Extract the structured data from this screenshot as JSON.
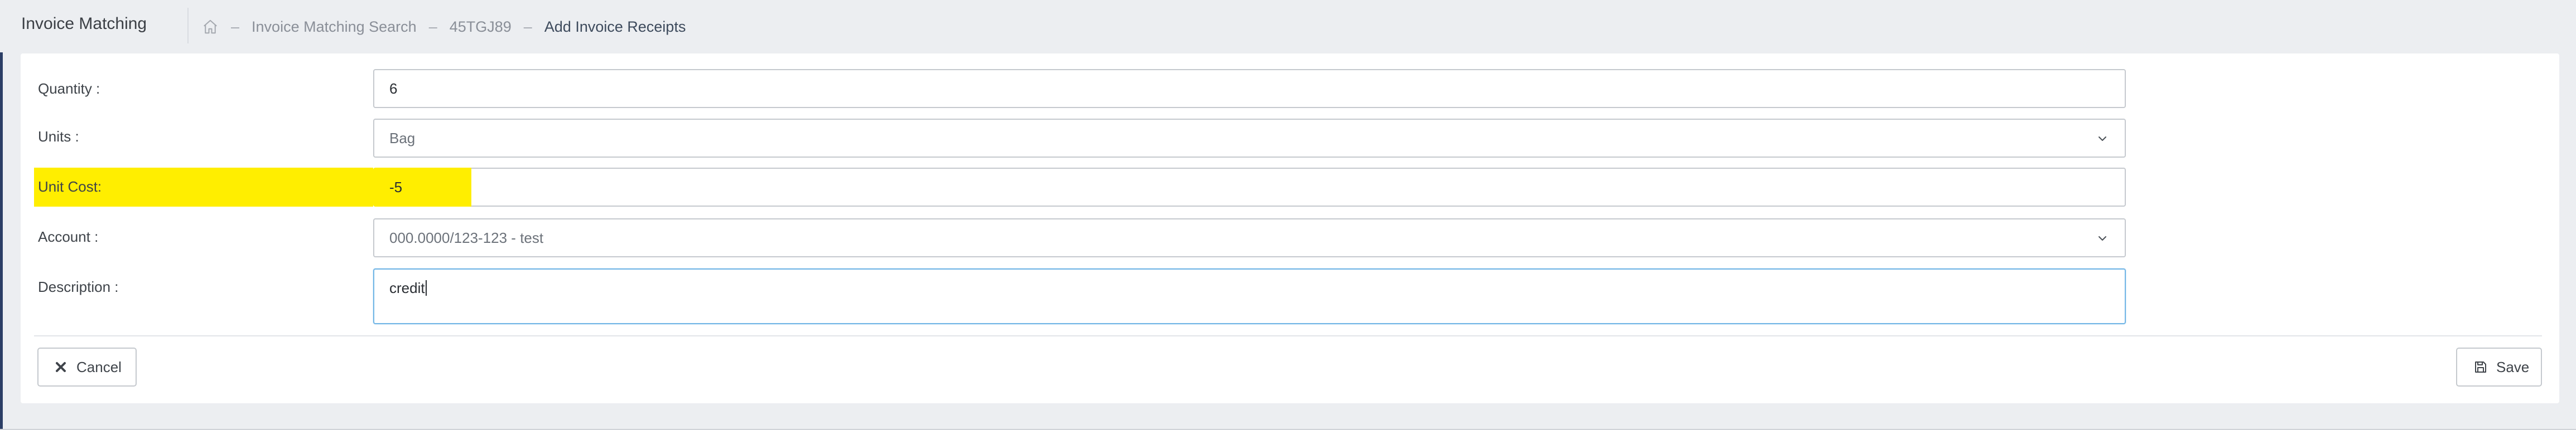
{
  "header": {
    "title": "Invoice Matching",
    "breadcrumb": {
      "separator": "–",
      "items": [
        "Invoice Matching Search",
        "45TGJ89",
        "Add Invoice Receipts"
      ]
    }
  },
  "form": {
    "quantity": {
      "label": "Quantity :",
      "value": "6"
    },
    "units": {
      "label": "Units :",
      "value": "Bag"
    },
    "unit_cost": {
      "label": "Unit Cost:",
      "value": "-5"
    },
    "account": {
      "label": "Account :",
      "value": "000.0000/123-123 - test"
    },
    "description": {
      "label": "Description :",
      "value": "credit"
    }
  },
  "actions": {
    "cancel_label": "Cancel",
    "save_label": "Save"
  },
  "colors": {
    "highlight": "#ffee00",
    "focus_border": "#73b6e6",
    "background": "#eceef1"
  }
}
